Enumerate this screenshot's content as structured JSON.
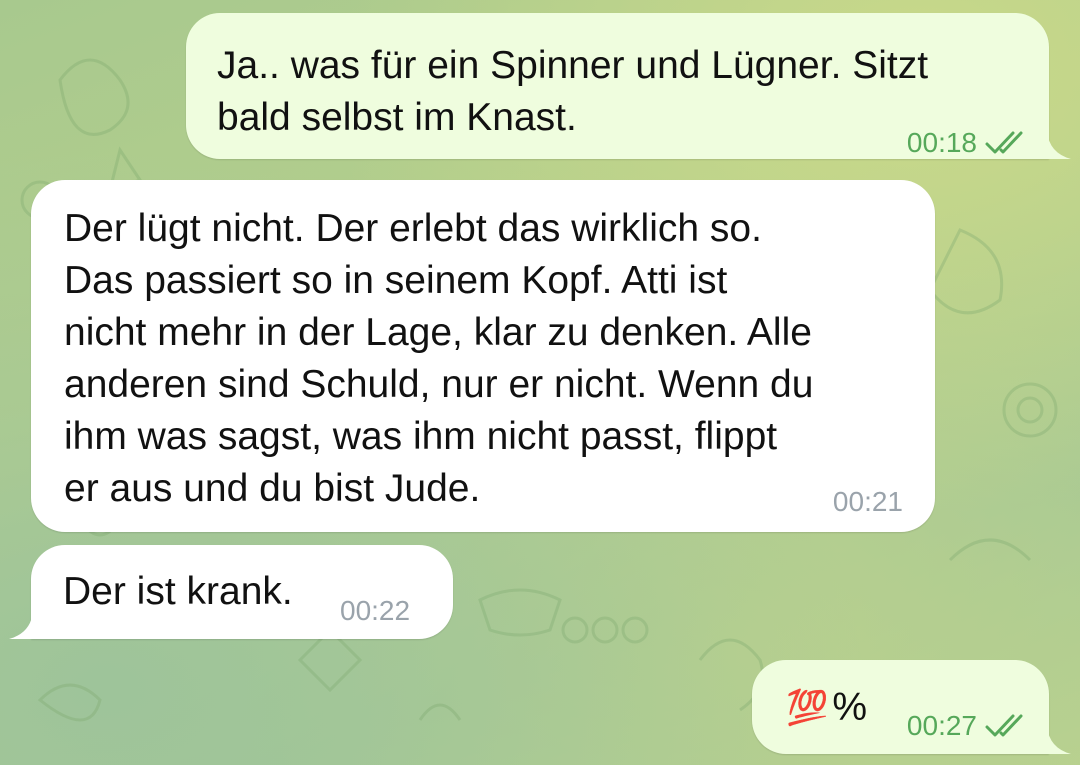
{
  "colors": {
    "outgoing_bubble": "#effdde",
    "incoming_bubble": "#ffffff",
    "outgoing_time": "#56a85a",
    "incoming_time": "#9aa3ab"
  },
  "messages": [
    {
      "direction": "outgoing",
      "text": "Ja.. was für ein Spinner und Lügner. Sitzt\nbald selbst im Knast.",
      "time": "00:18",
      "status_icon": "double-check-icon"
    },
    {
      "direction": "incoming",
      "text": "Der lügt nicht. Der erlebt das wirklich so.\nDas passiert so in seinem Kopf. Atti ist\nnicht mehr in der Lage, klar zu denken. Alle\nanderen sind Schuld, nur er nicht. Wenn du\nihm was sagst, was ihm nicht passt, flippt\ner aus und du bist Jude.",
      "time": "00:21"
    },
    {
      "direction": "incoming",
      "text": "Der ist krank.",
      "time": "00:22"
    },
    {
      "direction": "outgoing",
      "emoji": "💯",
      "text": "%",
      "time": "00:27",
      "status_icon": "double-check-icon"
    }
  ]
}
